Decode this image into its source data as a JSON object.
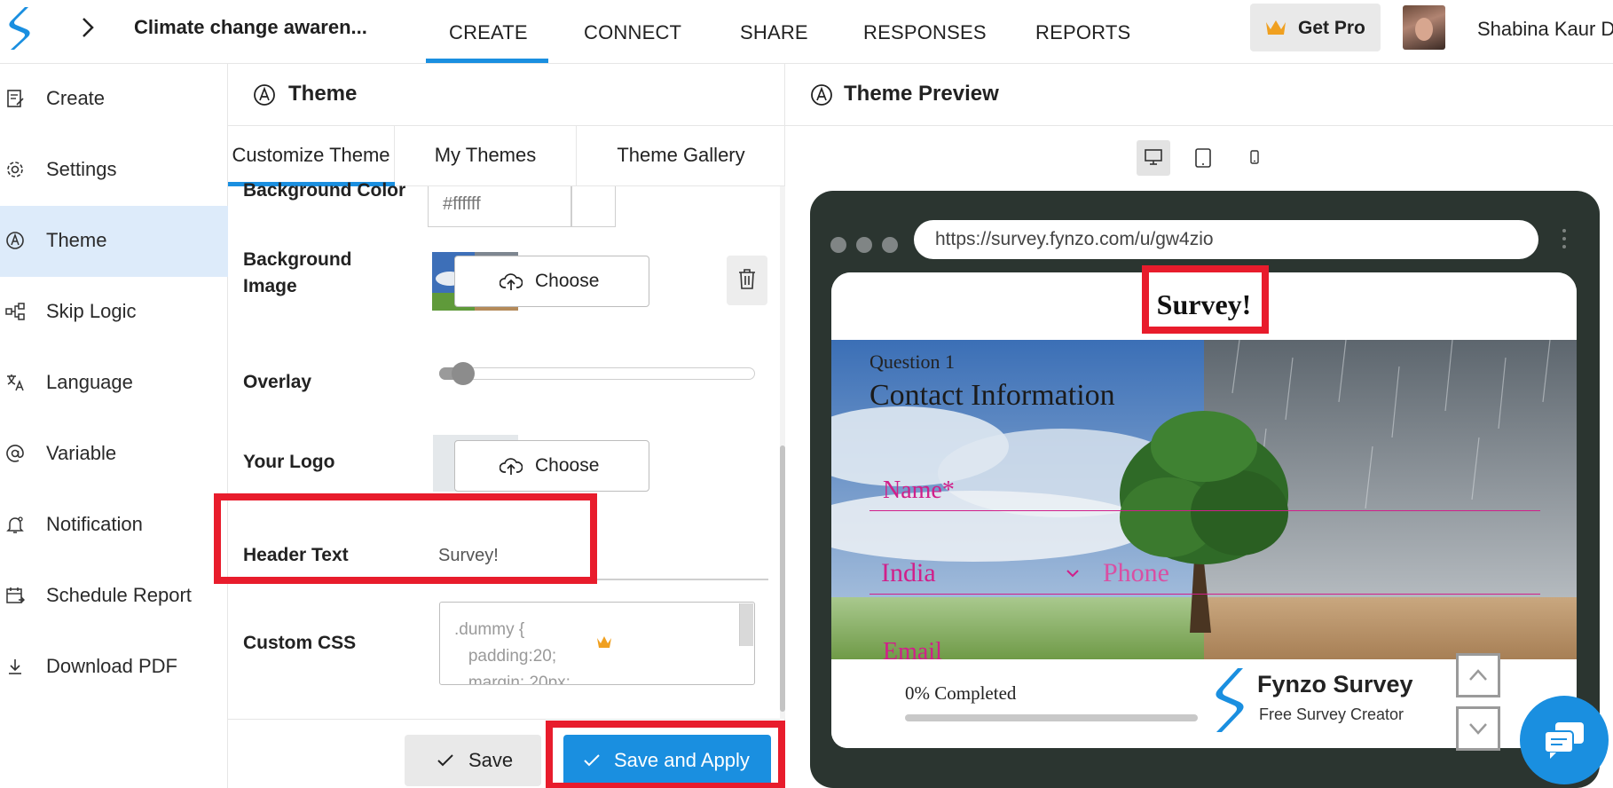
{
  "app": {
    "survey_title": "Climate change awaren...",
    "nav_tabs": [
      "CREATE",
      "CONNECT",
      "SHARE",
      "RESPONSES",
      "REPORTS"
    ],
    "active_nav_tab": "CREATE",
    "get_pro_label": "Get Pro",
    "user_name": "Shabina Kaur D",
    "accent_color": "#1a8fe0",
    "highlight_color": "#e81c2c"
  },
  "sidebar": {
    "items": [
      {
        "label": "Create",
        "icon": "edit-doc-icon"
      },
      {
        "label": "Settings",
        "icon": "gear-icon"
      },
      {
        "label": "Theme",
        "icon": "palette-icon"
      },
      {
        "label": "Skip Logic",
        "icon": "branch-icon"
      },
      {
        "label": "Language",
        "icon": "translate-icon"
      },
      {
        "label": "Variable",
        "icon": "at-sign-icon"
      },
      {
        "label": "Notification",
        "icon": "bell-icon"
      },
      {
        "label": "Schedule Report",
        "icon": "calendar-icon"
      },
      {
        "label": "Download PDF",
        "icon": "download-icon"
      }
    ],
    "active_item": "Theme"
  },
  "theme_panel": {
    "title": "Theme",
    "subtabs": [
      "Customize Theme",
      "My Themes",
      "Theme Gallery"
    ],
    "active_subtab": "Customize Theme",
    "fields": {
      "background_color_label": "Background Color",
      "background_color_value": "#ffffff",
      "background_image_label": "Background Image",
      "overlay_label": "Overlay",
      "overlay_value": 0.05,
      "logo_label": "Your Logo",
      "choose_label": "Choose",
      "header_text_label": "Header Text",
      "header_text_value": "Survey!",
      "custom_css_label": "Custom CSS",
      "custom_css_value": ".dummy {\n   padding:20;\n   margin: 20px;"
    },
    "save_label": "Save",
    "save_apply_label": "Save and Apply"
  },
  "preview": {
    "title": "Theme Preview",
    "device_modes": [
      "desktop",
      "tablet",
      "mobile"
    ],
    "active_device": "desktop",
    "url": "https://survey.fynzo.com/u/gw4zio",
    "header_text": "Survey!",
    "question_number": "Question 1",
    "question_title": "Contact Information",
    "name_placeholder": "Name*",
    "country_value": "India",
    "phone_placeholder": "Phone",
    "email_placeholder": "Email",
    "progress_label": "0% Completed",
    "progress_value": 0,
    "brand_name": "Fynzo Survey",
    "brand_tagline": "Free Survey Creator",
    "field_color": "#d11f8a"
  }
}
